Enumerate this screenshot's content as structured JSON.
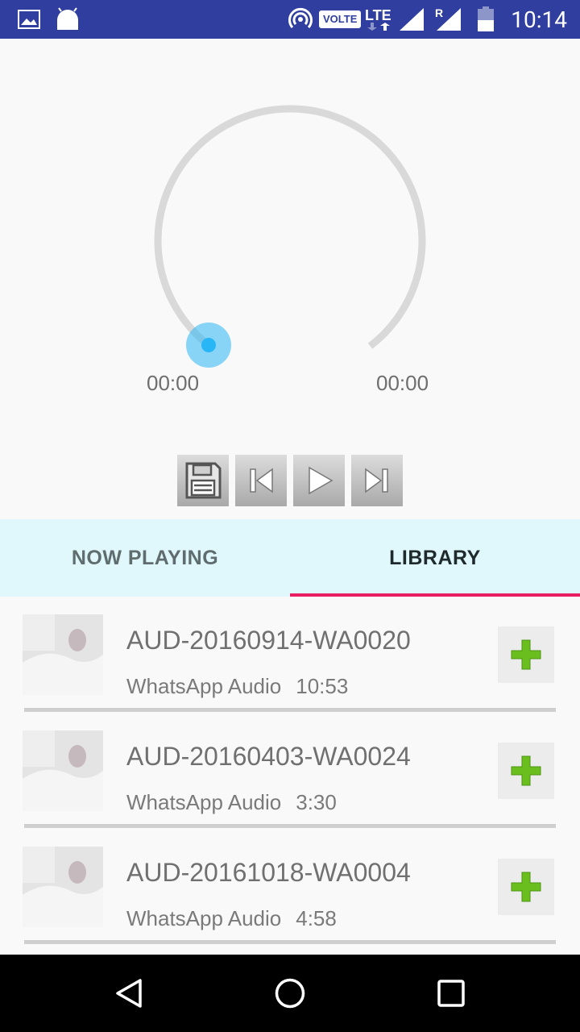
{
  "status_bar": {
    "time": "10:14",
    "volte_label": "VOLTE",
    "lte_label": "LTE",
    "roaming_label": "R",
    "icons": [
      "image-icon",
      "android-icon",
      "hotspot-icon",
      "signal-icon",
      "battery-icon"
    ]
  },
  "player": {
    "elapsed": "00:00",
    "total": "00:00",
    "progress": 0,
    "accent_color": "#29b6f6",
    "controls": [
      "save-icon",
      "previous-icon",
      "play-icon",
      "next-icon"
    ]
  },
  "tabs": {
    "now_playing": "NOW PLAYING",
    "library": "LIBRARY",
    "selected": "library",
    "indicator_color": "#e91e63"
  },
  "library": {
    "items": [
      {
        "title": "AUD-20160914-WA0020",
        "album": "WhatsApp Audio",
        "duration": "10:53"
      },
      {
        "title": "AUD-20160403-WA0024",
        "album": "WhatsApp Audio",
        "duration": "3:30"
      },
      {
        "title": "AUD-20161018-WA0004",
        "album": "WhatsApp Audio",
        "duration": "4:58"
      }
    ],
    "add_color": "#6abf1e"
  },
  "nav_bar": {
    "icons": [
      "back-icon",
      "home-icon",
      "recents-icon"
    ]
  }
}
